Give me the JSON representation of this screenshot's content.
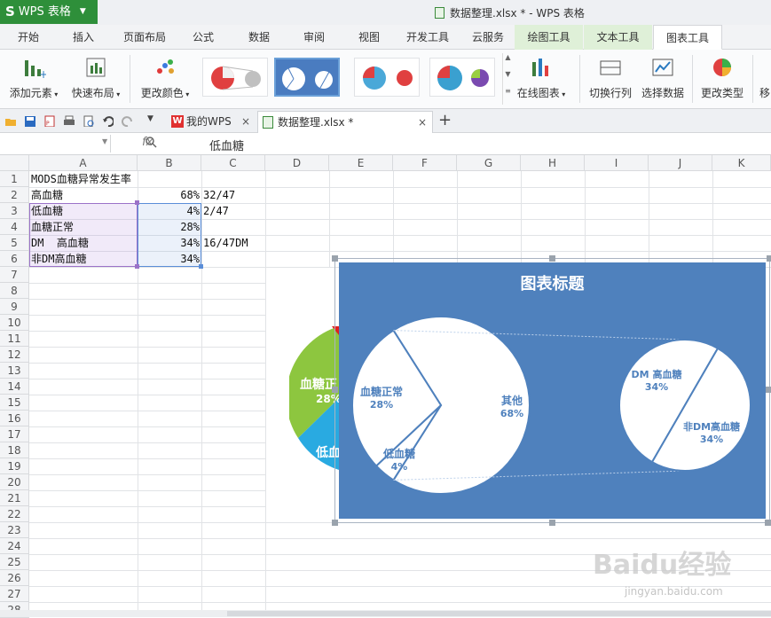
{
  "app": {
    "name": "WPS 表格",
    "window_title": "数据整理.xlsx * - WPS 表格"
  },
  "menu_tabs": [
    "开始",
    "插入",
    "页面布局",
    "公式",
    "数据",
    "审阅",
    "视图",
    "开发工具",
    "云服务",
    "绘图工具",
    "文本工具",
    "图表工具"
  ],
  "ribbon": {
    "add_element": "添加元素",
    "quick_layout": "快速布局",
    "change_color": "更改颜色",
    "online_chart": "在线图表",
    "switch_row_col": "切换行列",
    "select_data": "选择数据",
    "change_type": "更改类型",
    "move_partial": "移"
  },
  "doc_tabs": {
    "wps": "我的WPS",
    "file": "数据整理.xlsx *"
  },
  "formula": {
    "namebox": "",
    "fx": "fx",
    "content": "低血糖"
  },
  "columns": [
    "A",
    "B",
    "C",
    "D",
    "E",
    "F",
    "G",
    "H",
    "I",
    "J",
    "K"
  ],
  "rows": [
    "1",
    "2",
    "3",
    "4",
    "5",
    "6",
    "7",
    "8",
    "9",
    "10",
    "11",
    "12",
    "13",
    "14",
    "15",
    "16",
    "17",
    "18",
    "19",
    "20",
    "21",
    "22",
    "23",
    "24",
    "25",
    "26",
    "27",
    "28"
  ],
  "cells": {
    "a1": "MODS血糖异常发生率",
    "a2": "高血糖",
    "b2": "68%",
    "c2": "32/47",
    "a3": "低血糖",
    "b3": "4%",
    "c3": "2/47",
    "a4": "血糖正常",
    "b4": "28%",
    "a5": "DM  高血糖",
    "b5": "34%",
    "c5": "16/47DM",
    "a6": "非DM高血糖",
    "b6": "34%"
  },
  "behind_chart": {
    "label": "血糖正",
    "pct": "28%",
    "label2": "低血"
  },
  "chart_data": {
    "type": "pie",
    "subtype": "pie-of-pie",
    "title": "图表标题",
    "main_pie": [
      {
        "name": "血糖正常",
        "label": "28%",
        "value": 28
      },
      {
        "name": "低血糖",
        "label": "4%",
        "value": 4
      },
      {
        "name": "其他",
        "label": "68%",
        "value": 68
      }
    ],
    "secondary_pie": [
      {
        "name": "DM  高血糖",
        "label": "34%",
        "value": 34
      },
      {
        "name": "非DM高血糖",
        "label": "34%",
        "value": 34
      }
    ],
    "colors": {
      "background": "#4f81bd",
      "slice_fill": "#ffffff",
      "slice_stroke": "#4f81bd",
      "label": "#4f81bd"
    }
  },
  "watermark": {
    "text": "Baidu经验",
    "url_text": "jingyan.baidu.com"
  }
}
